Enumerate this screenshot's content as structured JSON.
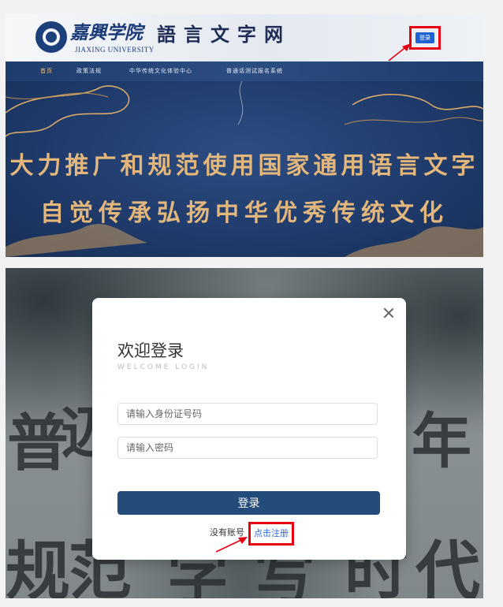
{
  "header": {
    "logo_cn": "嘉興学院",
    "logo_en": "JIAXING UNIVERSITY",
    "site_title": "語言文字网",
    "login_button": "登录"
  },
  "nav": {
    "items": [
      "首页",
      "政策法规",
      "中华传统文化体验中心",
      "普通话测试报名系统"
    ]
  },
  "banner": {
    "line1": "大力推广和规范使用国家通用语言文字",
    "line2": "自觉传承弘扬中华优秀传统文化"
  },
  "modal": {
    "title": "欢迎登录",
    "subtitle": "WELCOME LOGIN",
    "id_placeholder": "请输入身份证号码",
    "password_placeholder": "请输入密码",
    "submit_label": "登录",
    "no_account_text": "没有账号",
    "register_link": "点击注册"
  },
  "background_text": {
    "row1": [
      "普",
      "迈",
      "年"
    ],
    "row2": [
      "规",
      "范",
      "字",
      "写",
      "时",
      "代"
    ]
  },
  "colors": {
    "highlight_red": "#e60012",
    "nav_blue": "#1e3d6d",
    "banner_gold": "#e3b77b",
    "submit_blue": "#244c7b",
    "link_blue": "#2f6ad8"
  }
}
